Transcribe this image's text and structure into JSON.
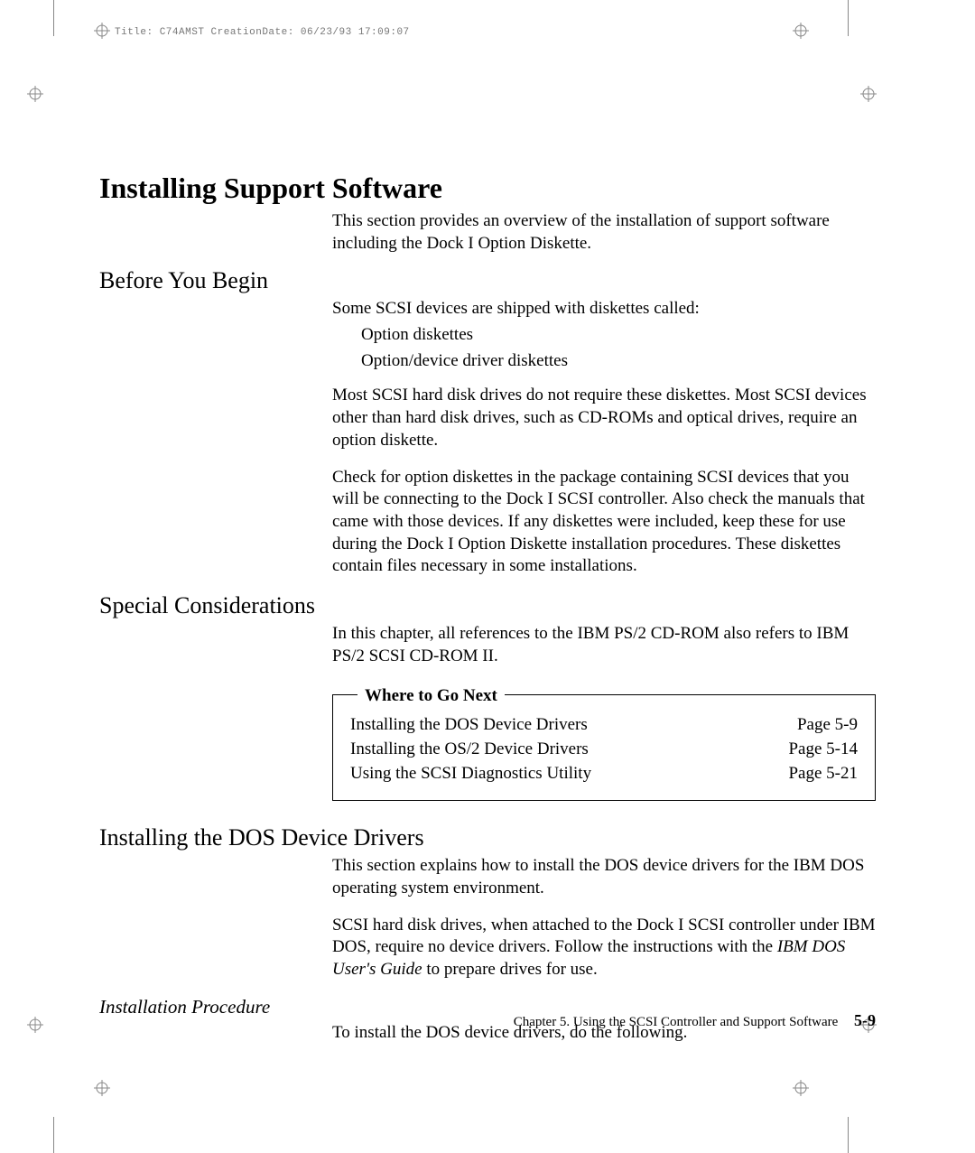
{
  "runhead": "Title: C74AMST CreationDate: 06/23/93 17:09:07",
  "title": "Installing Support Software",
  "intro": "This section provides an overview of the installation of support software including the Dock I Option Diskette.",
  "before": {
    "heading": "Before You Begin",
    "p1": "Some SCSI devices are shipped with diskettes called:",
    "bullets": [
      "Option diskettes",
      "Option/device driver diskettes"
    ],
    "p2": "Most SCSI hard disk drives do not require these diskettes.  Most SCSI devices other than hard disk drives, such as CD-ROMs and optical drives, require an option diskette.",
    "p3": "Check for option diskettes in the package containing SCSI devices that you will be connecting to the Dock I SCSI controller.  Also check the manuals that came with those devices.  If any diskettes were included, keep these for use during the Dock I Option Diskette installation procedures.  These diskettes contain files necessary in some installations."
  },
  "special": {
    "heading": "Special Considerations",
    "p1": "In this chapter, all references to the IBM PS/2 CD-ROM also refers to IBM PS/2 SCSI CD-ROM II."
  },
  "nextbox": {
    "title": "Where to Go Next",
    "rows": [
      {
        "label": "Installing the DOS Device Drivers",
        "page": "Page 5-9"
      },
      {
        "label": "Installing the OS/2 Device Drivers",
        "page": "Page 5-14"
      },
      {
        "label": "Using the SCSI Diagnostics Utility",
        "page": "Page 5-21"
      }
    ]
  },
  "dos": {
    "heading": "Installing the DOS Device Drivers",
    "p1": "This section explains how to install the DOS device drivers for the IBM DOS operating system environment.",
    "p2a": "SCSI hard disk drives, when attached to the Dock I SCSI controller under IBM DOS, require no device drivers.  Follow the instructions with the ",
    "p2book": "IBM DOS User's Guide",
    "p2b": " to prepare drives for use.",
    "proc_heading": "Installation Procedure",
    "proc_p1": "To install the DOS device drivers, do the following."
  },
  "footer": {
    "chapter": "Chapter 5.  Using the SCSI Controller and Support Software",
    "pagenum": "5-9"
  }
}
